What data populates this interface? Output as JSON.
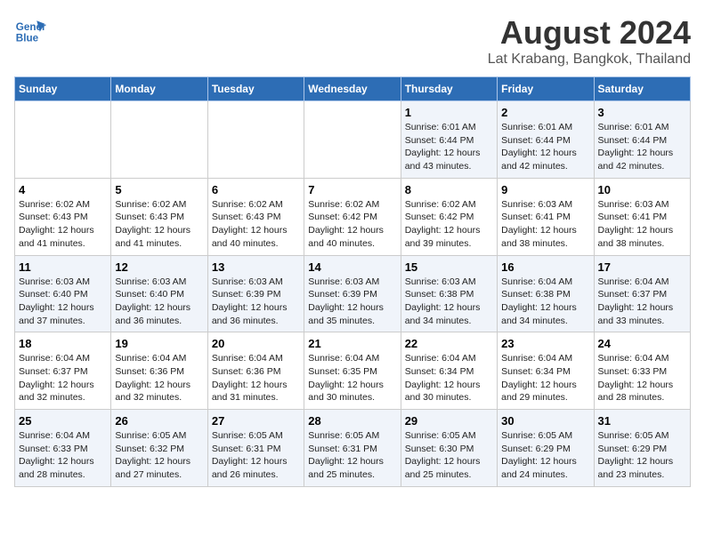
{
  "header": {
    "logo_line1": "General",
    "logo_line2": "Blue",
    "title": "August 2024",
    "subtitle": "Lat Krabang, Bangkok, Thailand"
  },
  "days_of_week": [
    "Sunday",
    "Monday",
    "Tuesday",
    "Wednesday",
    "Thursday",
    "Friday",
    "Saturday"
  ],
  "weeks": [
    [
      {
        "day": "",
        "content": ""
      },
      {
        "day": "",
        "content": ""
      },
      {
        "day": "",
        "content": ""
      },
      {
        "day": "",
        "content": ""
      },
      {
        "day": "1",
        "content": "Sunrise: 6:01 AM\nSunset: 6:44 PM\nDaylight: 12 hours\nand 43 minutes."
      },
      {
        "day": "2",
        "content": "Sunrise: 6:01 AM\nSunset: 6:44 PM\nDaylight: 12 hours\nand 42 minutes."
      },
      {
        "day": "3",
        "content": "Sunrise: 6:01 AM\nSunset: 6:44 PM\nDaylight: 12 hours\nand 42 minutes."
      }
    ],
    [
      {
        "day": "4",
        "content": "Sunrise: 6:02 AM\nSunset: 6:43 PM\nDaylight: 12 hours\nand 41 minutes."
      },
      {
        "day": "5",
        "content": "Sunrise: 6:02 AM\nSunset: 6:43 PM\nDaylight: 12 hours\nand 41 minutes."
      },
      {
        "day": "6",
        "content": "Sunrise: 6:02 AM\nSunset: 6:43 PM\nDaylight: 12 hours\nand 40 minutes."
      },
      {
        "day": "7",
        "content": "Sunrise: 6:02 AM\nSunset: 6:42 PM\nDaylight: 12 hours\nand 40 minutes."
      },
      {
        "day": "8",
        "content": "Sunrise: 6:02 AM\nSunset: 6:42 PM\nDaylight: 12 hours\nand 39 minutes."
      },
      {
        "day": "9",
        "content": "Sunrise: 6:03 AM\nSunset: 6:41 PM\nDaylight: 12 hours\nand 38 minutes."
      },
      {
        "day": "10",
        "content": "Sunrise: 6:03 AM\nSunset: 6:41 PM\nDaylight: 12 hours\nand 38 minutes."
      }
    ],
    [
      {
        "day": "11",
        "content": "Sunrise: 6:03 AM\nSunset: 6:40 PM\nDaylight: 12 hours\nand 37 minutes."
      },
      {
        "day": "12",
        "content": "Sunrise: 6:03 AM\nSunset: 6:40 PM\nDaylight: 12 hours\nand 36 minutes."
      },
      {
        "day": "13",
        "content": "Sunrise: 6:03 AM\nSunset: 6:39 PM\nDaylight: 12 hours\nand 36 minutes."
      },
      {
        "day": "14",
        "content": "Sunrise: 6:03 AM\nSunset: 6:39 PM\nDaylight: 12 hours\nand 35 minutes."
      },
      {
        "day": "15",
        "content": "Sunrise: 6:03 AM\nSunset: 6:38 PM\nDaylight: 12 hours\nand 34 minutes."
      },
      {
        "day": "16",
        "content": "Sunrise: 6:04 AM\nSunset: 6:38 PM\nDaylight: 12 hours\nand 34 minutes."
      },
      {
        "day": "17",
        "content": "Sunrise: 6:04 AM\nSunset: 6:37 PM\nDaylight: 12 hours\nand 33 minutes."
      }
    ],
    [
      {
        "day": "18",
        "content": "Sunrise: 6:04 AM\nSunset: 6:37 PM\nDaylight: 12 hours\nand 32 minutes."
      },
      {
        "day": "19",
        "content": "Sunrise: 6:04 AM\nSunset: 6:36 PM\nDaylight: 12 hours\nand 32 minutes."
      },
      {
        "day": "20",
        "content": "Sunrise: 6:04 AM\nSunset: 6:36 PM\nDaylight: 12 hours\nand 31 minutes."
      },
      {
        "day": "21",
        "content": "Sunrise: 6:04 AM\nSunset: 6:35 PM\nDaylight: 12 hours\nand 30 minutes."
      },
      {
        "day": "22",
        "content": "Sunrise: 6:04 AM\nSunset: 6:34 PM\nDaylight: 12 hours\nand 30 minutes."
      },
      {
        "day": "23",
        "content": "Sunrise: 6:04 AM\nSunset: 6:34 PM\nDaylight: 12 hours\nand 29 minutes."
      },
      {
        "day": "24",
        "content": "Sunrise: 6:04 AM\nSunset: 6:33 PM\nDaylight: 12 hours\nand 28 minutes."
      }
    ],
    [
      {
        "day": "25",
        "content": "Sunrise: 6:04 AM\nSunset: 6:33 PM\nDaylight: 12 hours\nand 28 minutes."
      },
      {
        "day": "26",
        "content": "Sunrise: 6:05 AM\nSunset: 6:32 PM\nDaylight: 12 hours\nand 27 minutes."
      },
      {
        "day": "27",
        "content": "Sunrise: 6:05 AM\nSunset: 6:31 PM\nDaylight: 12 hours\nand 26 minutes."
      },
      {
        "day": "28",
        "content": "Sunrise: 6:05 AM\nSunset: 6:31 PM\nDaylight: 12 hours\nand 25 minutes."
      },
      {
        "day": "29",
        "content": "Sunrise: 6:05 AM\nSunset: 6:30 PM\nDaylight: 12 hours\nand 25 minutes."
      },
      {
        "day": "30",
        "content": "Sunrise: 6:05 AM\nSunset: 6:29 PM\nDaylight: 12 hours\nand 24 minutes."
      },
      {
        "day": "31",
        "content": "Sunrise: 6:05 AM\nSunset: 6:29 PM\nDaylight: 12 hours\nand 23 minutes."
      }
    ]
  ]
}
